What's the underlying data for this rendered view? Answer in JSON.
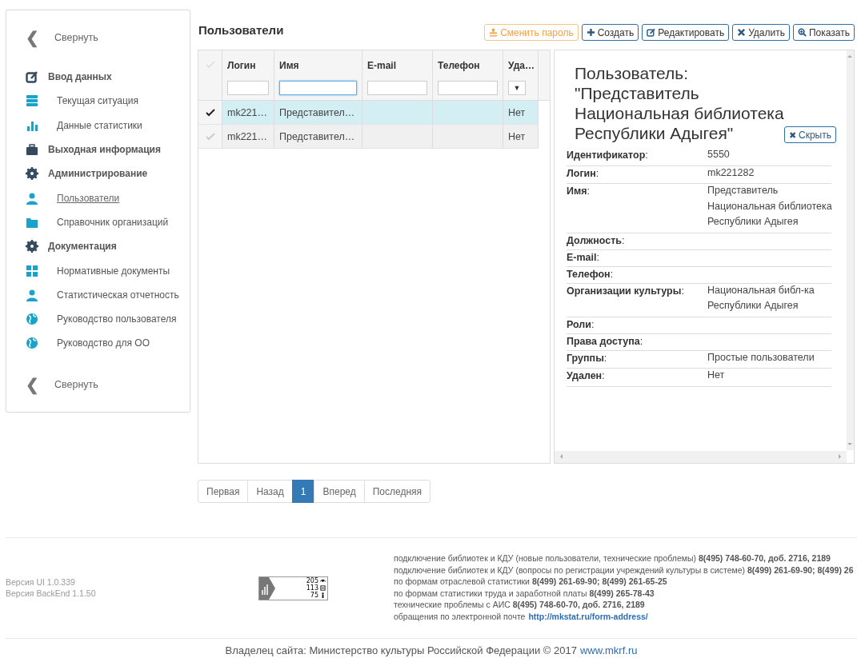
{
  "sidebar": {
    "collapse_top": {
      "icon": "❮",
      "label": "Свернуть"
    },
    "items": [
      {
        "kind": "section",
        "label": "Ввод данных",
        "selected": false
      },
      {
        "kind": "item",
        "label": "Текущая ситуация",
        "selected": false
      },
      {
        "kind": "item",
        "label": "Данные статистики",
        "selected": false
      },
      {
        "kind": "section",
        "label": "Выходная информация",
        "selected": false
      },
      {
        "kind": "section",
        "label": "Администрирование",
        "selected": false
      },
      {
        "kind": "item",
        "label": "Пользователи",
        "selected": true
      },
      {
        "kind": "item",
        "label": "Справочник организаций",
        "selected": false
      },
      {
        "kind": "section",
        "label": "Документация",
        "selected": false
      },
      {
        "kind": "item",
        "label": "Нормативные документы",
        "selected": false
      },
      {
        "kind": "item",
        "label": "Статистическая отчетность",
        "selected": false
      },
      {
        "kind": "item",
        "label": "Руководство пользователя",
        "selected": false
      },
      {
        "kind": "item",
        "label": "Руководство для ОО",
        "selected": false
      }
    ],
    "collapse_bottom": {
      "icon": "❮",
      "label": "Свернуть"
    }
  },
  "page_title": "Пользователи",
  "toolbar": [
    {
      "kind": "warning",
      "label": "Сменить пароль"
    },
    {
      "kind": "default",
      "label": "Создать"
    },
    {
      "kind": "default",
      "label": "Редактировать"
    },
    {
      "kind": "default",
      "label": "Удалить"
    },
    {
      "kind": "default",
      "label": "Показать"
    }
  ],
  "table": {
    "columns": [
      "Логин",
      "Имя",
      "E-mail",
      "Телефон",
      "Уда…"
    ],
    "filters": [
      {
        "kind": "text",
        "focused": false
      },
      {
        "kind": "text",
        "focused": true
      },
      {
        "kind": "text",
        "focused": false
      },
      {
        "kind": "text",
        "focused": false
      },
      {
        "kind": "select",
        "value": "▼"
      }
    ],
    "rows": [
      {
        "selected": true,
        "login": "mk221…",
        "name": "Представител…",
        "deleted": "Нет"
      },
      {
        "selected": false,
        "login": "mk221…",
        "name": "Представител…",
        "deleted": "Нет"
      }
    ]
  },
  "detail": {
    "title_lines": [
      "Пользователь:",
      "\"Представитель",
      "Национальная библиотека",
      "Республики Адыгея\""
    ],
    "hide_button": {
      "icon": "✖",
      "label": "Скрыть"
    },
    "fields": [
      {
        "label": "**Идентификатор**:",
        "value_lines": [
          "5550"
        ]
      },
      {
        "label": "**Логин**:",
        "value_lines": [
          "mk221282"
        ]
      },
      {
        "label": "**Имя**:",
        "value_lines": [
          "Представитель",
          "Национальная библиотека",
          "Республики Адыгея"
        ]
      },
      {
        "label": "**Должность**:"
      },
      {
        "label": "**E-mail**:"
      },
      {
        "label": "**Телефон**:"
      },
      {
        "label": "**Организации культуры**:",
        "value_lines": [
          "Национальная библ-ка",
          "Республики Адыгея"
        ]
      },
      {
        "label": "**Роли**:"
      },
      {
        "label": "**Права доступа**:"
      },
      {
        "label": "**Группы**:",
        "value_lines": [
          "Простые пользователи"
        ]
      },
      {
        "label": "**Удален**:",
        "value_lines": [
          "Нет"
        ]
      }
    ]
  },
  "pagination": [
    {
      "label": "Первая",
      "selected": false
    },
    {
      "label": "Назад",
      "selected": false
    },
    {
      "label": "1",
      "selected": true
    },
    {
      "label": "Вперед",
      "selected": false
    },
    {
      "label": "Последняя",
      "selected": false
    }
  ],
  "footer": {
    "versions": [
      "Версия UI 1.0.339",
      "Версия BackEnd 1.1.50"
    ],
    "counter": [
      "205",
      "113",
      "75"
    ],
    "contacts": [
      {
        "text": "подключение библиотек и КДУ (новые пользователи, технические проблемы) **8(495) 748-60-70, доб. 2716, 2189**"
      },
      {
        "text": "подключение библиотек и КДУ (вопросы по регистрации учреждений культуры в системе) **8(499) 261-69-90; 8(499) 26**"
      },
      {
        "text": "по формам отраслевой статистики **8(499) 261-69-90; 8(499) 261-65-25**"
      },
      {
        "text": "по формам статистики труда и заработной платы **8(499) 265-78-43**"
      },
      {
        "text": "технические проблемы с АИС **8(495) 748-60-70, доб. 2716, 2189**"
      },
      {
        "text": "обращения по электронной почте",
        "link": "http://mkstat.ru/form-address/"
      }
    ],
    "copyright": "Владелец сайта: Министерство культуры Российской Федерации © 2017",
    "site_link": "www.mkrf.ru"
  }
}
